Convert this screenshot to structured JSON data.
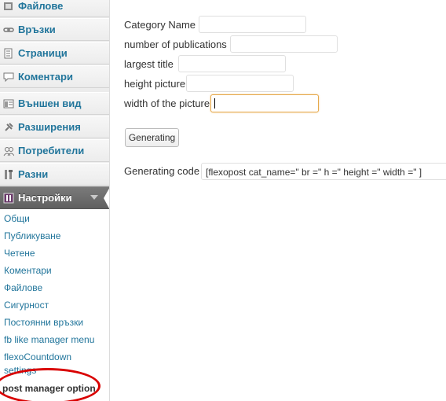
{
  "sidebar": {
    "items": [
      {
        "label": "Файлове",
        "icon": "media-icon"
      },
      {
        "label": "Връзки",
        "icon": "links-icon"
      },
      {
        "label": "Страници",
        "icon": "pages-icon"
      },
      {
        "label": "Коментари",
        "icon": "comments-icon"
      },
      {
        "label": "Външен вид",
        "icon": "appearance-icon"
      },
      {
        "label": "Разширения",
        "icon": "plugins-icon"
      },
      {
        "label": "Потребители",
        "icon": "users-icon"
      },
      {
        "label": "Разни",
        "icon": "tools-icon"
      },
      {
        "label": "Настройки",
        "icon": "settings-icon",
        "active": true
      }
    ],
    "submenu": [
      "Общи",
      "Публикуване",
      "Четене",
      "Коментари",
      "Файлове",
      "Сигурност",
      "Постоянни връзки",
      "fb like manager menu",
      "flexoCountdown",
      "settings",
      "post manager option"
    ]
  },
  "form": {
    "category_name_label": "Category Name",
    "category_name_value": "",
    "num_publications_label": "number of publications",
    "num_publications_value": "",
    "largest_title_label": "largest title",
    "largest_title_value": "",
    "height_picture_label": "height picture",
    "height_picture_value": "",
    "width_picture_label": "width of the picture",
    "width_picture_value": "",
    "generate_button": "Generating",
    "generating_code_label": "Generating code",
    "generating_code_value": "[flexopost cat_name=\" br =\" h =\" height =\" width =\" ]"
  },
  "colors": {
    "link": "#21759b",
    "active_menu": "#6d6d6d",
    "focus_border": "#e6a84a",
    "annotation_circle": "#d90000"
  }
}
